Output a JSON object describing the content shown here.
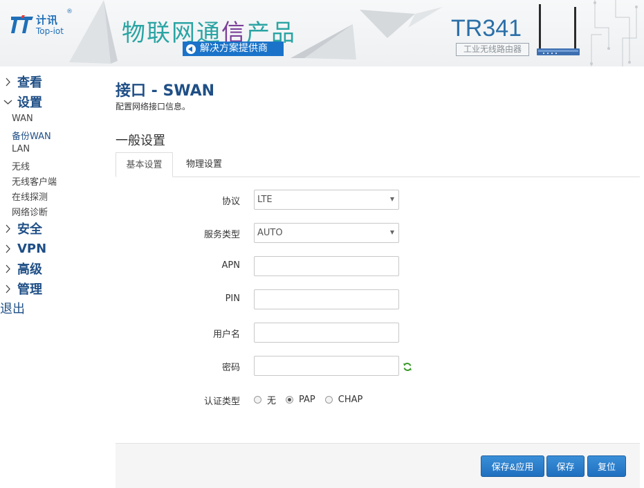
{
  "header": {
    "logo_cn": "计讯",
    "logo_reg": "®",
    "logo_en": "Top-iot",
    "slogan_part1": "物联网通",
    "slogan_part2": "信",
    "slogan_part3": "产品",
    "tag": "解决方案提供商",
    "model": "TR341",
    "model_sub": "工业无线路由器",
    "colors": {
      "brand_blue": "#1f6fb8",
      "teal": "#2aa4a3",
      "accent_purple": "#7b3f9a"
    }
  },
  "sidebar": {
    "sections": [
      {
        "label": "查看",
        "expanded": false
      },
      {
        "label": "设置",
        "expanded": true
      },
      {
        "label": "安全",
        "expanded": false
      },
      {
        "label": "VPN",
        "expanded": false
      },
      {
        "label": "高级",
        "expanded": false
      },
      {
        "label": "管理",
        "expanded": false
      }
    ],
    "subitems": [
      "WAN",
      "备份WAN",
      "LAN",
      "无线",
      "无线客户端",
      "在线探测",
      "网络诊断"
    ],
    "active_subitem": "备份WAN",
    "logout": "退出"
  },
  "main": {
    "title": "接口 - SWAN",
    "description": "配置网络接口信息。",
    "section": "一般设置",
    "tabs": [
      "基本设置",
      "物理设置"
    ],
    "active_tab": "基本设置",
    "fields": {
      "protocol": {
        "label": "协议",
        "value": "LTE"
      },
      "service_type": {
        "label": "服务类型",
        "value": "AUTO"
      },
      "apn": {
        "label": "APN",
        "value": ""
      },
      "pin": {
        "label": "PIN",
        "value": ""
      },
      "username": {
        "label": "用户名",
        "value": ""
      },
      "password": {
        "label": "密码",
        "value": ""
      },
      "auth_type": {
        "label": "认证类型",
        "options": [
          "无",
          "PAP",
          "CHAP"
        ],
        "selected": "PAP"
      }
    }
  },
  "footer": {
    "save_apply": "保存&应用",
    "save": "保存",
    "reset": "复位"
  }
}
